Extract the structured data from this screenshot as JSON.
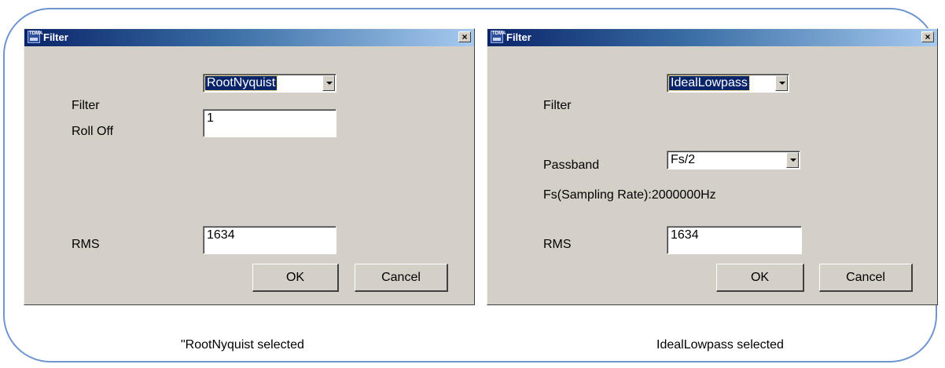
{
  "left_dialog": {
    "title": "Filter",
    "close_glyph": "×",
    "filter_label": "Filter",
    "filter_value": "RootNyquist",
    "rolloff_label": "Roll Off",
    "rolloff_value": "1",
    "rms_label": "RMS",
    "rms_value": "1634",
    "ok_label": "OK",
    "cancel_label": "Cancel"
  },
  "right_dialog": {
    "title": "Filter",
    "close_glyph": "×",
    "filter_label": "Filter",
    "filter_value": "IdealLowpass",
    "passband_label": "Passband",
    "passband_value": "Fs/2",
    "sampling_text": "Fs(Sampling Rate):2000000Hz",
    "rms_label": "RMS",
    "rms_value": "1634",
    "ok_label": "OK",
    "cancel_label": "Cancel"
  },
  "captions": {
    "left": "\"RootNyquist selected",
    "right": "IdealLowpass selected"
  },
  "icons": {
    "app": "tdma-app-icon",
    "close": "close-icon",
    "dropdown": "chevron-down-icon"
  },
  "colors": {
    "titlebar_start": "#0a246a",
    "titlebar_end": "#a6caf0",
    "dialog_bg": "#d4d0c8",
    "frame_border": "#6f95cf"
  }
}
